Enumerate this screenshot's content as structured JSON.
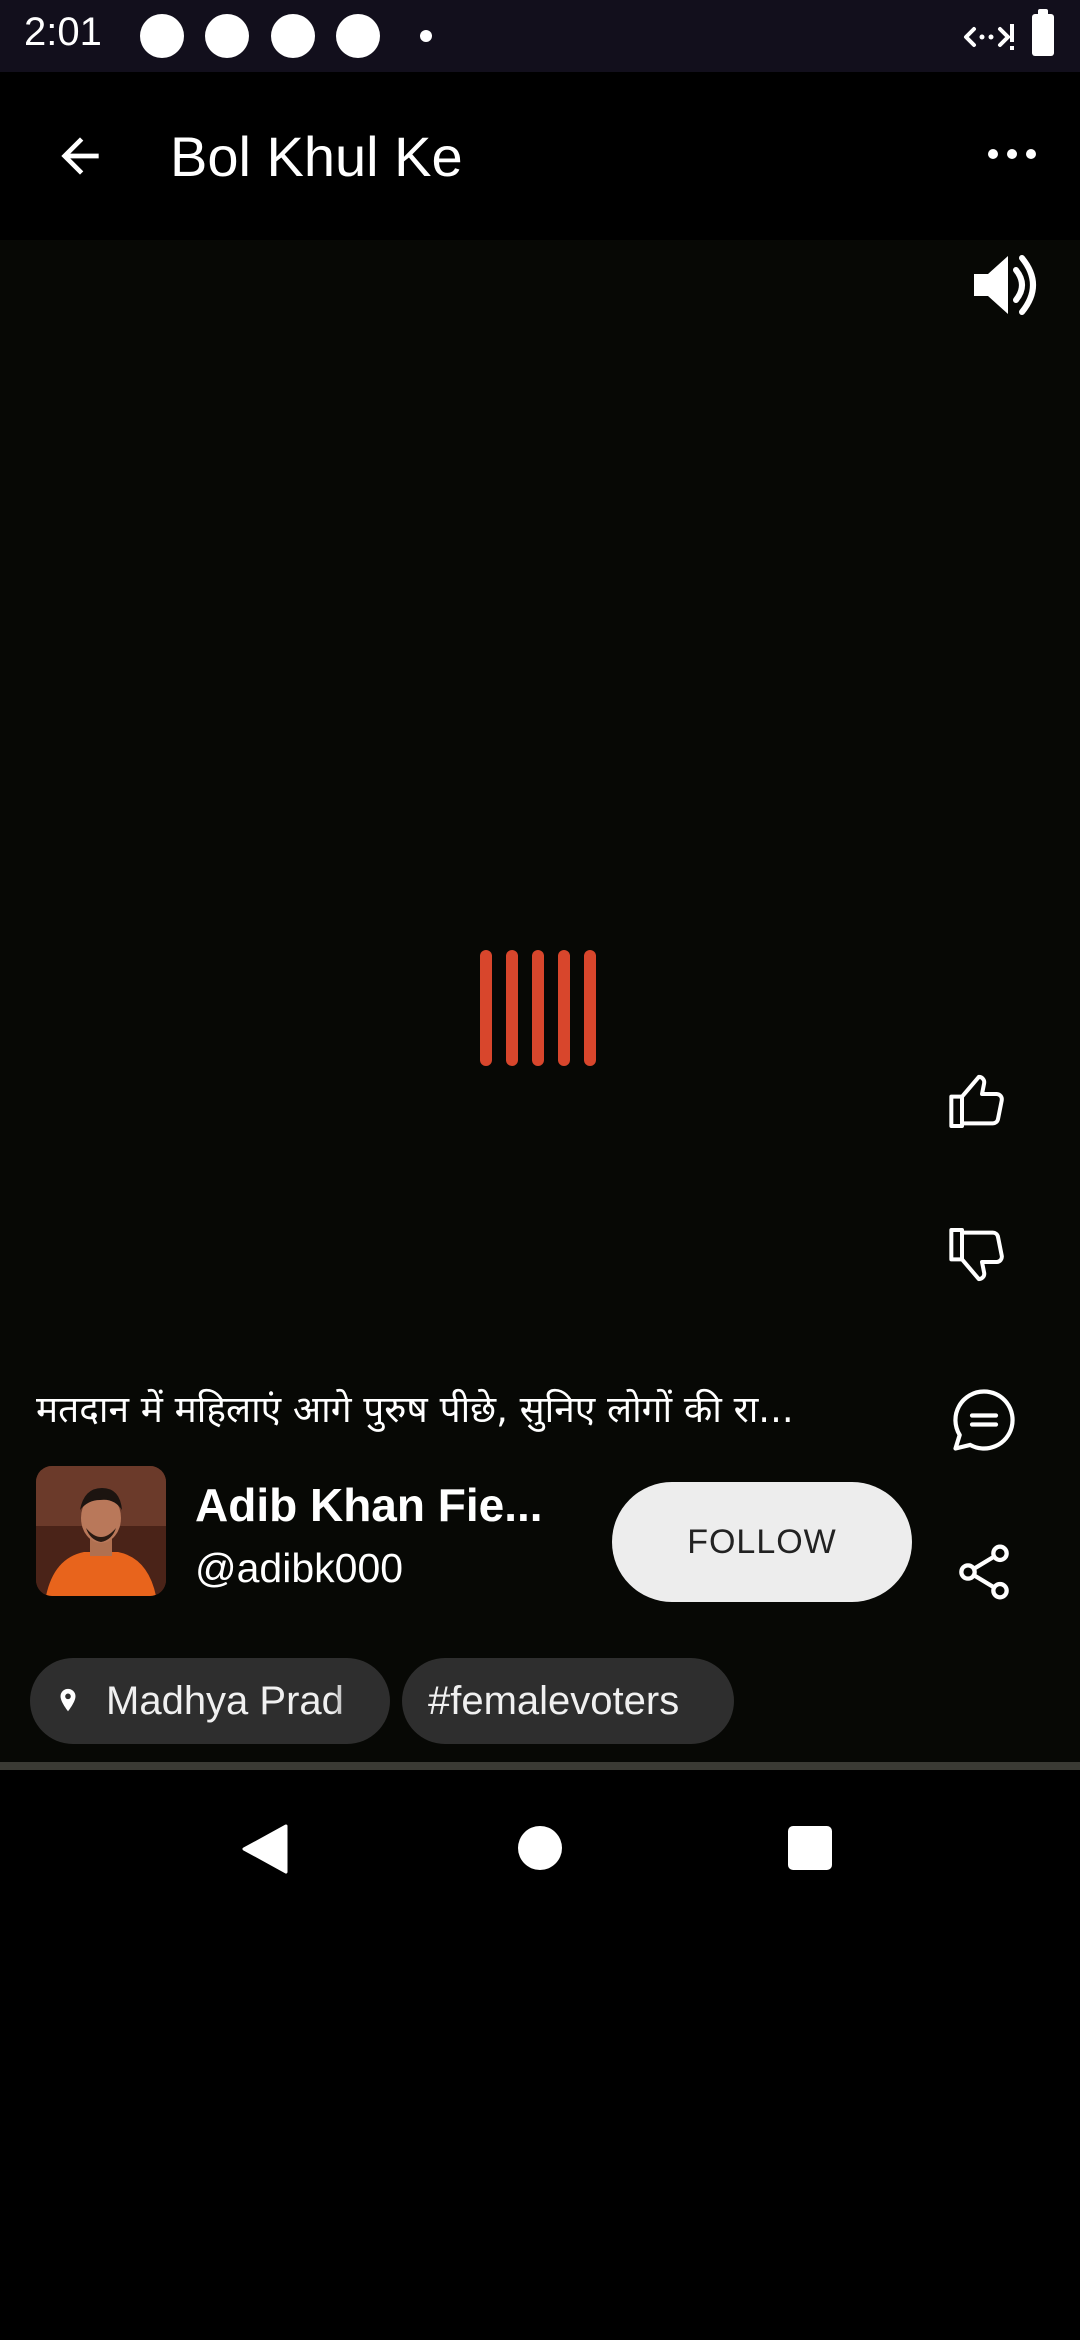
{
  "status_bar": {
    "time": "2:01",
    "icons": [
      "notification-dot",
      "notification-dot",
      "notification-dot",
      "notification-dot",
      "notification-small-dot",
      "wifi-off-icon",
      "battery-icon"
    ]
  },
  "app_bar": {
    "title": "Bol Khul Ke",
    "back_icon": "arrow-back-icon",
    "menu_icon": "more-horizontal-icon"
  },
  "video": {
    "volume_icon": "volume-on-icon",
    "loader_color": "#d8462c"
  },
  "actions": {
    "like_icon": "thumbs-up-icon",
    "dislike_icon": "thumbs-down-icon",
    "comment_icon": "comment-icon",
    "share_icon": "share-icon"
  },
  "post": {
    "caption": "मतदान में महिलाएं आगे पुरुष पीछे, सुनिए लोगों की रा...",
    "creator_name": "Adib Khan Fie...",
    "creator_handle": "@adibk000",
    "follow_label": "FOLLOW"
  },
  "chips": {
    "location_icon": "location-pin-icon",
    "location": "Madhya Prad",
    "hashtag": "#femalevoters"
  },
  "nav_bar": {
    "back": "nav-back-icon",
    "home": "nav-home-icon",
    "recents": "nav-recents-icon"
  }
}
